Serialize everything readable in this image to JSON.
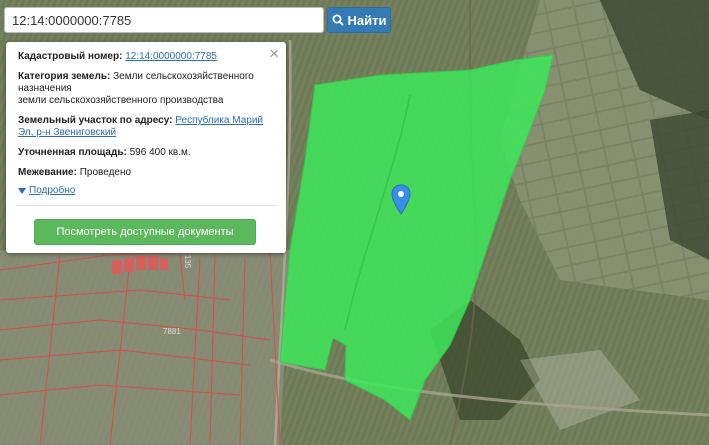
{
  "search": {
    "value": "12:14:0000000:7785",
    "button_label": "Найти",
    "button_icon": "search-icon"
  },
  "info_panel": {
    "cadastral_label": "Кадастровый номер:",
    "cadastral_value": "12:14:0000000:7785",
    "category_label": "Категория земель:",
    "category_value": "Земли сельскохозяйственного назначения",
    "category_line2": "земли сельскохозяйственного производства",
    "address_label": "Земельный участок по адресу:",
    "address_value": "Республика Марий Эл, р-н Звениговский",
    "area_label": "Уточненная площадь:",
    "area_value": "596 400 кв.м.",
    "survey_label": "Межевание:",
    "survey_value": "Проведено",
    "more_link": "Подробно",
    "docs_button": "Посмотреть доступные документы",
    "close_symbol": "×"
  },
  "map": {
    "parcel_labels": [
      "7881",
      "135"
    ],
    "parcel_color": "#3ee85a",
    "boundary_color": "#e04848",
    "marker_color": "#3a8ee6"
  }
}
